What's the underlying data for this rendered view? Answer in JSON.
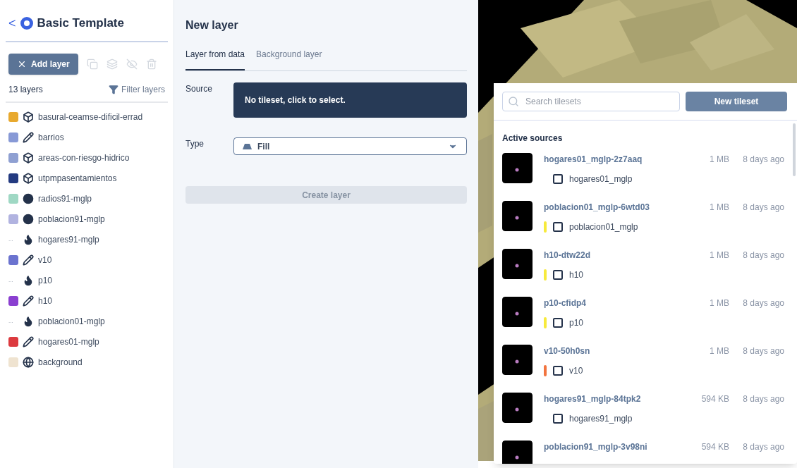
{
  "sidebar": {
    "back": "<",
    "title": "Basic Template",
    "add_button": "Add layer",
    "layer_count": "13 layers",
    "filter": "Filter layers",
    "layers": [
      {
        "kind": "extrusion",
        "name": "basural-ceamse-dificil-errad",
        "color": "#e8a92e"
      },
      {
        "kind": "line",
        "name": "barrios",
        "color": "#8799d6"
      },
      {
        "kind": "extrusion",
        "name": "areas-con-riesgo-hidrico",
        "color": "#8fa0d2"
      },
      {
        "kind": "extrusion",
        "name": "utpmpasentamientos",
        "color": "#233a80"
      },
      {
        "kind": "circle",
        "name": "radios91-mglp",
        "color": "#9fd8c4"
      },
      {
        "kind": "circle",
        "name": "poblacion91-mglp",
        "color": "#b1b3e0"
      },
      {
        "kind": "heatmap",
        "name": "hogares91-mglp",
        "swatch": "..."
      },
      {
        "kind": "line",
        "name": "v10",
        "color": "#6b73cf"
      },
      {
        "kind": "heatmap",
        "name": "p10",
        "swatch": "..."
      },
      {
        "kind": "line",
        "name": "h10",
        "color": "#8a3fd0"
      },
      {
        "kind": "heatmap",
        "name": "poblacion01-mglp",
        "swatch": "..."
      },
      {
        "kind": "line",
        "name": "hogares01-mglp",
        "color": "#dc3a3f"
      },
      {
        "kind": "background",
        "name": "background",
        "color": "#efe3d0"
      }
    ]
  },
  "panel": {
    "title": "New layer",
    "tabs": [
      {
        "label": "Layer from data",
        "selected": true
      },
      {
        "label": "Background layer",
        "selected": false
      }
    ],
    "source_label": "Source",
    "source_value": "No tileset, click to select.",
    "type_label": "Type",
    "type_value": "Fill",
    "create_button": "Create layer",
    "create_disabled": true
  },
  "tileset_popover": {
    "search_placeholder": "Search tilesets",
    "new_button": "New tileset",
    "section": "Active sources",
    "sources": [
      {
        "name": "hogares01_mglp-2z7aaq",
        "size": "1 MB",
        "age": "8 days ago",
        "layer": "hogares01_mglp"
      },
      {
        "name": "poblacion01_mglp-6wtd03",
        "size": "1 MB",
        "age": "8 days ago",
        "layer": "poblacion01_mglp",
        "color": "#f7ea3c"
      },
      {
        "name": "h10-dtw22d",
        "size": "1 MB",
        "age": "8 days ago",
        "layer": "h10",
        "color": "#f7ea3c"
      },
      {
        "name": "p10-cfidp4",
        "size": "1 MB",
        "age": "8 days ago",
        "layer": "p10",
        "color": "#f7ea3c"
      },
      {
        "name": "v10-50h0sn",
        "size": "1 MB",
        "age": "8 days ago",
        "layer": "v10",
        "color": "#f2743f"
      },
      {
        "name": "hogares91_mglp-84tpk2",
        "size": "594 KB",
        "age": "8 days ago",
        "layer": "hogares91_mglp"
      },
      {
        "name": "poblacion91_mglp-3v98ni",
        "size": "594 KB",
        "age": "8 days ago"
      }
    ]
  }
}
